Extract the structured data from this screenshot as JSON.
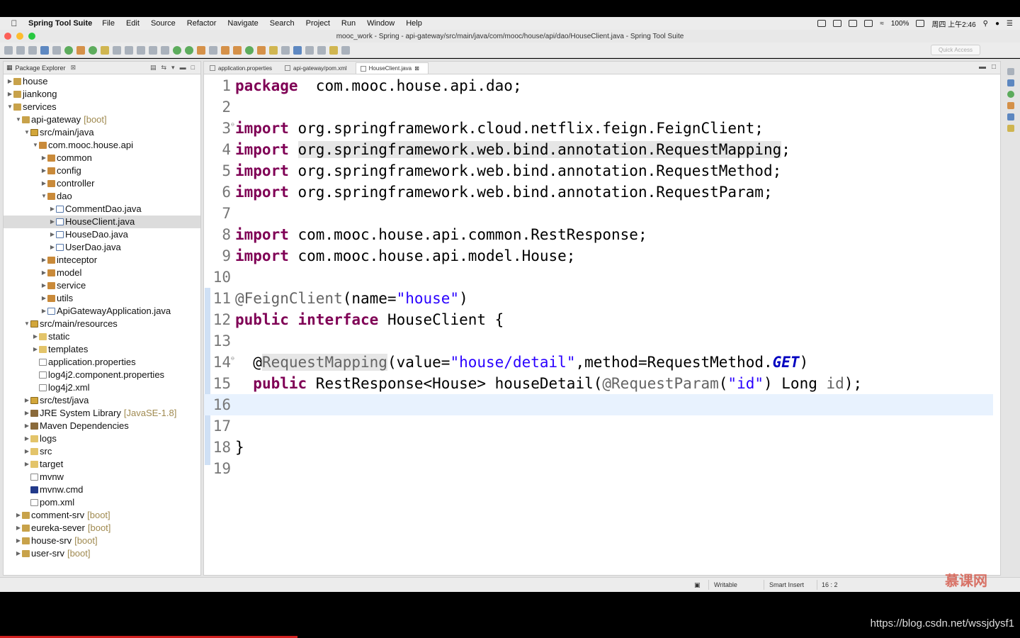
{
  "menubar": {
    "app": "Spring Tool Suite",
    "items": [
      "File",
      "Edit",
      "Source",
      "Refactor",
      "Navigate",
      "Search",
      "Project",
      "Run",
      "Window",
      "Help"
    ],
    "battery": "100%",
    "clock": "周四 上午2:46"
  },
  "window": {
    "title": "mooc_work - Spring - api-gateway/src/main/java/com/mooc/house/api/dao/HouseClient.java - Spring Tool Suite",
    "quick_access": "Quick Access",
    "traffic_colors": [
      "#fc5f57",
      "#fdbc2e",
      "#28c840"
    ]
  },
  "explorer": {
    "title": "Package Explorer",
    "close": "⊠",
    "tree": [
      {
        "label": "house",
        "indent": 0,
        "twisty": "▶",
        "icon": "proj",
        "badge": ""
      },
      {
        "label": "jiankong",
        "indent": 0,
        "twisty": "▶",
        "icon": "proj",
        "badge": ""
      },
      {
        "label": "services",
        "indent": 0,
        "twisty": "▼",
        "icon": "proj",
        "badge": ""
      },
      {
        "label": "api-gateway",
        "indent": 1,
        "twisty": "▼",
        "icon": "proj",
        "badge": "[boot]"
      },
      {
        "label": "src/main/java",
        "indent": 2,
        "twisty": "▼",
        "icon": "srcf",
        "badge": ""
      },
      {
        "label": "com.mooc.house.api",
        "indent": 3,
        "twisty": "▼",
        "icon": "pkg",
        "badge": ""
      },
      {
        "label": "common",
        "indent": 4,
        "twisty": "▶",
        "icon": "pkg",
        "badge": ""
      },
      {
        "label": "config",
        "indent": 4,
        "twisty": "▶",
        "icon": "pkg",
        "badge": ""
      },
      {
        "label": "controller",
        "indent": 4,
        "twisty": "▶",
        "icon": "pkg",
        "badge": ""
      },
      {
        "label": "dao",
        "indent": 4,
        "twisty": "▼",
        "icon": "pkg",
        "badge": ""
      },
      {
        "label": "CommentDao.java",
        "indent": 5,
        "twisty": "▶",
        "icon": "java",
        "badge": ""
      },
      {
        "label": "HouseClient.java",
        "indent": 5,
        "twisty": "▶",
        "icon": "java",
        "badge": "",
        "selected": true
      },
      {
        "label": "HouseDao.java",
        "indent": 5,
        "twisty": "▶",
        "icon": "java",
        "badge": ""
      },
      {
        "label": "UserDao.java",
        "indent": 5,
        "twisty": "▶",
        "icon": "java",
        "badge": ""
      },
      {
        "label": "inteceptor",
        "indent": 4,
        "twisty": "▶",
        "icon": "pkg",
        "badge": ""
      },
      {
        "label": "model",
        "indent": 4,
        "twisty": "▶",
        "icon": "pkg",
        "badge": ""
      },
      {
        "label": "service",
        "indent": 4,
        "twisty": "▶",
        "icon": "pkg",
        "badge": ""
      },
      {
        "label": "utils",
        "indent": 4,
        "twisty": "▶",
        "icon": "pkg",
        "badge": ""
      },
      {
        "label": "ApiGatewayApplication.java",
        "indent": 4,
        "twisty": "▶",
        "icon": "java",
        "badge": ""
      },
      {
        "label": "src/main/resources",
        "indent": 2,
        "twisty": "▼",
        "icon": "srcf",
        "badge": ""
      },
      {
        "label": "static",
        "indent": 3,
        "twisty": "▶",
        "icon": "folder",
        "badge": ""
      },
      {
        "label": "templates",
        "indent": 3,
        "twisty": "▶",
        "icon": "folder",
        "badge": ""
      },
      {
        "label": "application.properties",
        "indent": 3,
        "twisty": "",
        "icon": "file",
        "badge": ""
      },
      {
        "label": "log4j2.component.properties",
        "indent": 3,
        "twisty": "",
        "icon": "file",
        "badge": ""
      },
      {
        "label": "log4j2.xml",
        "indent": 3,
        "twisty": "",
        "icon": "file",
        "badge": ""
      },
      {
        "label": "src/test/java",
        "indent": 2,
        "twisty": "▶",
        "icon": "srcf",
        "badge": ""
      },
      {
        "label": "JRE System Library",
        "indent": 2,
        "twisty": "▶",
        "icon": "lib",
        "badge": "[JavaSE-1.8]"
      },
      {
        "label": "Maven Dependencies",
        "indent": 2,
        "twisty": "▶",
        "icon": "lib",
        "badge": ""
      },
      {
        "label": "logs",
        "indent": 2,
        "twisty": "▶",
        "icon": "folder",
        "badge": ""
      },
      {
        "label": "src",
        "indent": 2,
        "twisty": "▶",
        "icon": "folder",
        "badge": ""
      },
      {
        "label": "target",
        "indent": 2,
        "twisty": "▶",
        "icon": "folder",
        "badge": ""
      },
      {
        "label": "mvnw",
        "indent": 2,
        "twisty": "",
        "icon": "file",
        "badge": ""
      },
      {
        "label": "mvnw.cmd",
        "indent": 2,
        "twisty": "",
        "icon": "cmd",
        "badge": ""
      },
      {
        "label": "pom.xml",
        "indent": 2,
        "twisty": "",
        "icon": "file",
        "badge": ""
      },
      {
        "label": "comment-srv",
        "indent": 1,
        "twisty": "▶",
        "icon": "proj",
        "badge": "[boot]"
      },
      {
        "label": "eureka-sever",
        "indent": 1,
        "twisty": "▶",
        "icon": "proj",
        "badge": "[boot]"
      },
      {
        "label": "house-srv",
        "indent": 1,
        "twisty": "▶",
        "icon": "proj",
        "badge": "[boot]"
      },
      {
        "label": "user-srv",
        "indent": 1,
        "twisty": "▶",
        "icon": "proj",
        "badge": "[boot]"
      }
    ]
  },
  "editor": {
    "tabs": [
      {
        "label": "application.properties",
        "active": false
      },
      {
        "label": "api-gateway/pom.xml",
        "active": false
      },
      {
        "label": "HouseClient.java",
        "active": true
      }
    ],
    "current_line": 16,
    "lines": [
      {
        "n": "1",
        "tokens": [
          [
            "kw",
            "package"
          ],
          [
            "",
            "  com.mooc.house.api.dao;"
          ]
        ]
      },
      {
        "n": "2",
        "tokens": []
      },
      {
        "n": "3",
        "fold": true,
        "tokens": [
          [
            "kw",
            "import"
          ],
          [
            "",
            " org.springframework.cloud.netflix.feign.FeignClient;"
          ]
        ]
      },
      {
        "n": "4",
        "tokens": [
          [
            "kw",
            "import"
          ],
          [
            "",
            " "
          ],
          [
            "hl",
            "org.springframework.web.bind.annotation.RequestMapping"
          ],
          [
            "",
            ";"
          ]
        ]
      },
      {
        "n": "5",
        "tokens": [
          [
            "kw",
            "import"
          ],
          [
            "",
            " org.springframework.web.bind.annotation.RequestMethod;"
          ]
        ]
      },
      {
        "n": "6",
        "tokens": [
          [
            "kw",
            "import"
          ],
          [
            "",
            " org.springframework.web.bind.annotation.RequestParam;"
          ]
        ]
      },
      {
        "n": "7",
        "tokens": []
      },
      {
        "n": "8",
        "tokens": [
          [
            "kw",
            "import"
          ],
          [
            "",
            " com.mooc.house.api.common.RestResponse;"
          ]
        ]
      },
      {
        "n": "9",
        "tokens": [
          [
            "kw",
            "import"
          ],
          [
            "",
            " com.mooc.house.api.model.House;"
          ]
        ]
      },
      {
        "n": "10",
        "tokens": []
      },
      {
        "n": "11",
        "tokens": [
          [
            "ann",
            "@FeignClient"
          ],
          [
            "",
            "(name="
          ],
          [
            "str",
            "\"house\""
          ],
          [
            "",
            ")"
          ]
        ]
      },
      {
        "n": "12",
        "tokens": [
          [
            "kw",
            "public"
          ],
          [
            "",
            " "
          ],
          [
            "kw",
            "interface"
          ],
          [
            "",
            " HouseClient {"
          ]
        ]
      },
      {
        "n": "13",
        "tokens": []
      },
      {
        "n": "14",
        "fold": true,
        "tokens": [
          [
            "",
            "  @"
          ],
          [
            "hlann",
            "RequestMapping"
          ],
          [
            "",
            "(value="
          ],
          [
            "str",
            "\"house/detail\""
          ],
          [
            "",
            ",method=RequestMethod."
          ],
          [
            "ital",
            "GET"
          ],
          [
            "",
            ")"
          ]
        ]
      },
      {
        "n": "15",
        "tokens": [
          [
            "",
            "  "
          ],
          [
            "kw",
            "public"
          ],
          [
            "",
            " RestResponse<House> houseDetail("
          ],
          [
            "ann",
            "@RequestParam"
          ],
          [
            "",
            "("
          ],
          [
            "str",
            "\"id\""
          ],
          [
            "",
            ") Long "
          ],
          [
            "ann",
            "id"
          ],
          [
            "",
            ");"
          ]
        ]
      },
      {
        "n": "16",
        "tokens": []
      },
      {
        "n": "17",
        "tokens": []
      },
      {
        "n": "18",
        "tokens": [
          [
            "",
            "}"
          ]
        ]
      },
      {
        "n": "19",
        "tokens": []
      }
    ]
  },
  "status": {
    "writable": "Writable",
    "insert_mode": "Smart Insert",
    "position": "16 : 2"
  },
  "watermark": "慕课网",
  "url": "https://blog.csdn.net/wssjdysf1"
}
